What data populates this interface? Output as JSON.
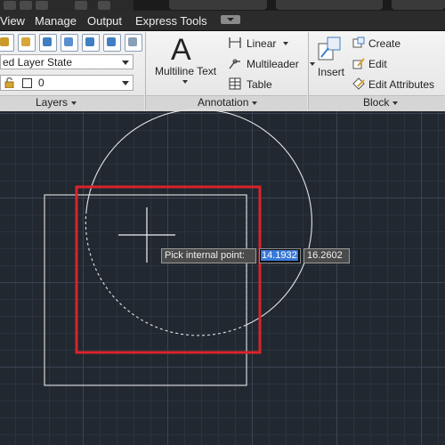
{
  "menubar": {
    "items": [
      "View",
      "Manage",
      "Output",
      "Express Tools"
    ]
  },
  "ribbon": {
    "layers": {
      "layer_state": "ed Layer State",
      "layer_name": "0",
      "title": "Layers"
    },
    "annotation": {
      "multiline_text": "Multiline Text",
      "linear": "Linear",
      "multileader": "Multileader",
      "table": "Table",
      "title": "Annotation"
    },
    "block": {
      "insert": "Insert",
      "create": "Create",
      "edit": "Edit",
      "edit_attributes": "Edit Attributes",
      "title": "Block"
    }
  },
  "canvas": {
    "prompt_label": "Pick internal point:",
    "coord_x": "14.1932",
    "coord_y": "16.2602"
  },
  "icons": [
    "lock-icon",
    "color-swatch-icon",
    "linear-dimension-icon",
    "multileader-icon",
    "table-icon",
    "insert-block-icon",
    "create-block-icon",
    "edit-block-icon",
    "edit-attributes-icon",
    "crosshair-cursor"
  ],
  "colors": {
    "canvas_bg": "#212830",
    "highlight_rect": "#d9232a",
    "coord_selected": "#3a7ad8"
  }
}
